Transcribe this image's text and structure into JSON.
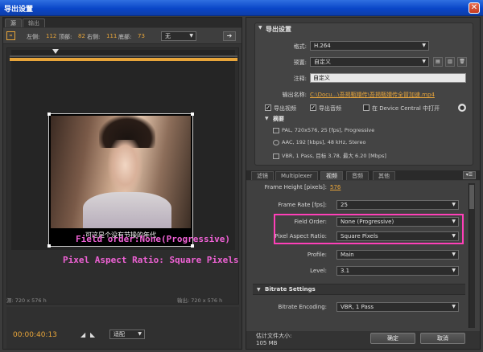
{
  "window": {
    "title": "导出设置",
    "close_glyph": "✕"
  },
  "left": {
    "tabs": [
      {
        "label": "源"
      },
      {
        "label": "输出"
      }
    ],
    "crop": {
      "left_label": "左侧:",
      "left_value": "112",
      "top_label": "顶部:",
      "top_value": "82",
      "right_label": "右侧:",
      "right_value": "111",
      "bottom_label": "底部:",
      "bottom_value": "73",
      "ratio_select": "无"
    },
    "subtitle": "可这是个没有节操的年代",
    "source_info": "源: 720 x 576 h",
    "output_info": "输出: 720 x 576 h",
    "timecode": "00:00:40:13",
    "fit_select": "适配"
  },
  "overlays": {
    "line1": "Field order:None(Progressive)",
    "line2": "Pixel Aspect Ratio: Square Pixels"
  },
  "export": {
    "header": "导出设置",
    "format_label": "格式:",
    "format_value": "H.264",
    "preset_label": "预置:",
    "preset_value": "自定义",
    "comment_label": "注释:",
    "comment_value": "自定义",
    "output_name_label": "输出名称:",
    "output_name_value": "C:\\Docu...\\吾揭甄嬛传\\吾揭甄嬛传全冒加速.mp4",
    "export_video_label": "导出视频",
    "export_audio_label": "导出音频",
    "device_central_label": "在 Device Central 中打开",
    "summary_header": "摘要",
    "summary": [
      "PAL, 720x576, 25 [fps], Progressive",
      "AAC, 192 [kbps], 48 kHz, Stereo",
      "VBR, 1 Pass, 目标 3.78, 最大 6.20 [Mbps]"
    ]
  },
  "tabs2": [
    "滤镜",
    "Multiplexer",
    "视频",
    "音频",
    "其他"
  ],
  "video": {
    "frame_height_label": "Frame Height [pixels]:",
    "frame_height_value": "576",
    "frame_rate_label": "Frame Rate [fps]:",
    "frame_rate_value": "25",
    "field_order_label": "Field Order:",
    "field_order_value": "None (Progressive)",
    "par_label": "Pixel Aspect Ratio:",
    "par_value": "Square Pixels",
    "profile_label": "Profile:",
    "profile_value": "Main",
    "level_label": "Level:",
    "level_value": "3.1",
    "bitrate_header": "Bitrate Settings",
    "bitrate_encoding_label": "Bitrate Encoding:",
    "bitrate_encoding_value": "VBR, 1 Pass"
  },
  "footer": {
    "filesize_label": "估计文件大小:",
    "filesize_value": "105 MB",
    "ok_label": "确定",
    "cancel_label": "取消"
  },
  "colors": {
    "accent": "#e8a53a",
    "highlight": "#ff3fb8",
    "overlay_text": "#f062d6",
    "titlebar": "#0a46c8"
  }
}
